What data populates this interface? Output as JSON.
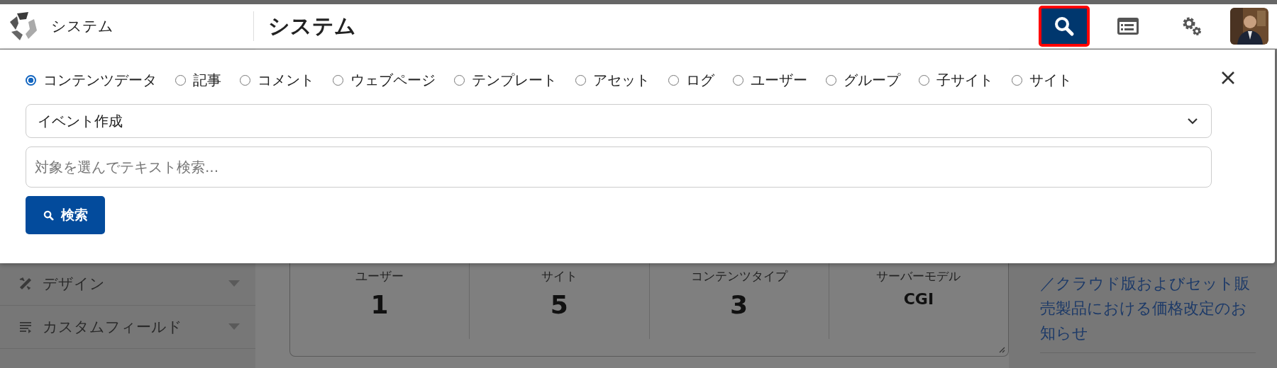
{
  "header": {
    "app_name": "システム",
    "title": "システム",
    "nav_icons": [
      {
        "kind": "search",
        "selected": true
      },
      {
        "kind": "window",
        "selected": false
      },
      {
        "kind": "settings",
        "selected": false
      }
    ]
  },
  "search_panel": {
    "scopes": [
      {
        "label": "コンテンツデータ",
        "selected": true
      },
      {
        "label": "記事",
        "selected": false
      },
      {
        "label": "コメント",
        "selected": false
      },
      {
        "label": "ウェブページ",
        "selected": false
      },
      {
        "label": "テンプレート",
        "selected": false
      },
      {
        "label": "アセット",
        "selected": false
      },
      {
        "label": "ログ",
        "selected": false
      },
      {
        "label": "ユーザー",
        "selected": false
      },
      {
        "label": "グループ",
        "selected": false
      },
      {
        "label": "子サイト",
        "selected": false
      },
      {
        "label": "サイト",
        "selected": false
      }
    ],
    "select": {
      "value": "イベント作成"
    },
    "input": {
      "placeholder": "対象を選んでテキスト検索..."
    },
    "button": {
      "label": "検索"
    }
  },
  "sidebar": {
    "items": [
      {
        "label": "デザイン",
        "kind": "design"
      },
      {
        "label": "カスタムフィールド",
        "kind": "fields"
      }
    ]
  },
  "stats": [
    {
      "label": "ユーザー",
      "value": "1",
      "kind": "count"
    },
    {
      "label": "サイト",
      "value": "5",
      "kind": "count"
    },
    {
      "label": "コンテンツタイプ",
      "value": "3",
      "kind": "count"
    },
    {
      "label": "サーバーモデル",
      "value": "CGI",
      "kind": "text"
    }
  ],
  "news": {
    "link": "／クラウド版およびセット販売製品における価格改定のお知らせ"
  }
}
